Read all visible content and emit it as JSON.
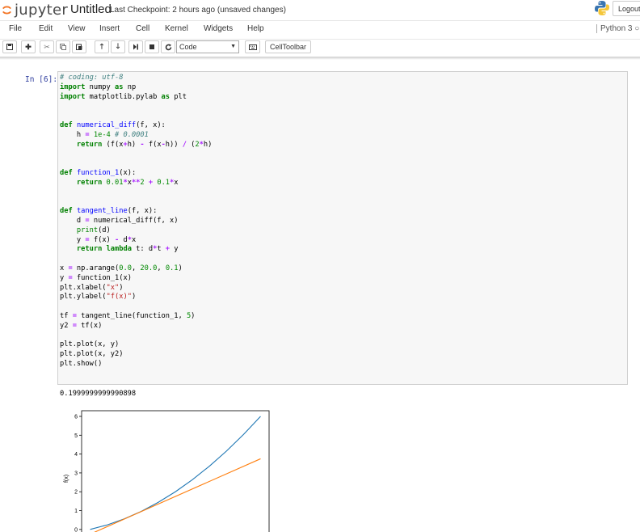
{
  "header": {
    "logo_text": "jupyter",
    "notebook_title": "Untitled",
    "checkpoint": "Last Checkpoint: 2 hours ago (unsaved changes)",
    "logout_label": "Logout"
  },
  "menubar": {
    "items": [
      "File",
      "Edit",
      "View",
      "Insert",
      "Cell",
      "Kernel",
      "Widgets",
      "Help"
    ],
    "kernel_indicator": "Python 3"
  },
  "toolbar": {
    "buttons": [
      "save-icon",
      "plus-icon",
      "scissors-icon",
      "copy-icon",
      "paste-icon",
      "arrow-up-icon",
      "arrow-down-icon",
      "step-forward-icon",
      "stop-icon",
      "restart-icon",
      "keyboard-icon"
    ],
    "cell_type": "Code",
    "celltoolbar_label": "CellToolbar"
  },
  "cell": {
    "prompt": "In [6]:",
    "output_text": "0.1999999999990898"
  },
  "colors": {
    "series1": "#1f77b4",
    "series2": "#ff7f0e",
    "prompt": "#303f9f"
  },
  "chart_data": {
    "type": "line",
    "xlabel": "",
    "ylabel": "f(x)",
    "ylim": [
      -0.35,
      6.3
    ],
    "xlim": [
      -1.0,
      21.0
    ],
    "yticks": [
      0,
      1,
      2,
      3,
      4,
      5,
      6
    ],
    "series": [
      {
        "x": [
          0,
          2,
          4,
          6,
          8,
          10,
          12,
          14,
          16,
          18,
          20
        ],
        "values": [
          0.0,
          0.24,
          0.56,
          0.96,
          1.44,
          2.0,
          2.64,
          3.36,
          4.16,
          5.04,
          6.0
        ]
      },
      {
        "x": [
          0,
          20
        ],
        "values": [
          -0.25,
          3.75
        ]
      }
    ]
  }
}
